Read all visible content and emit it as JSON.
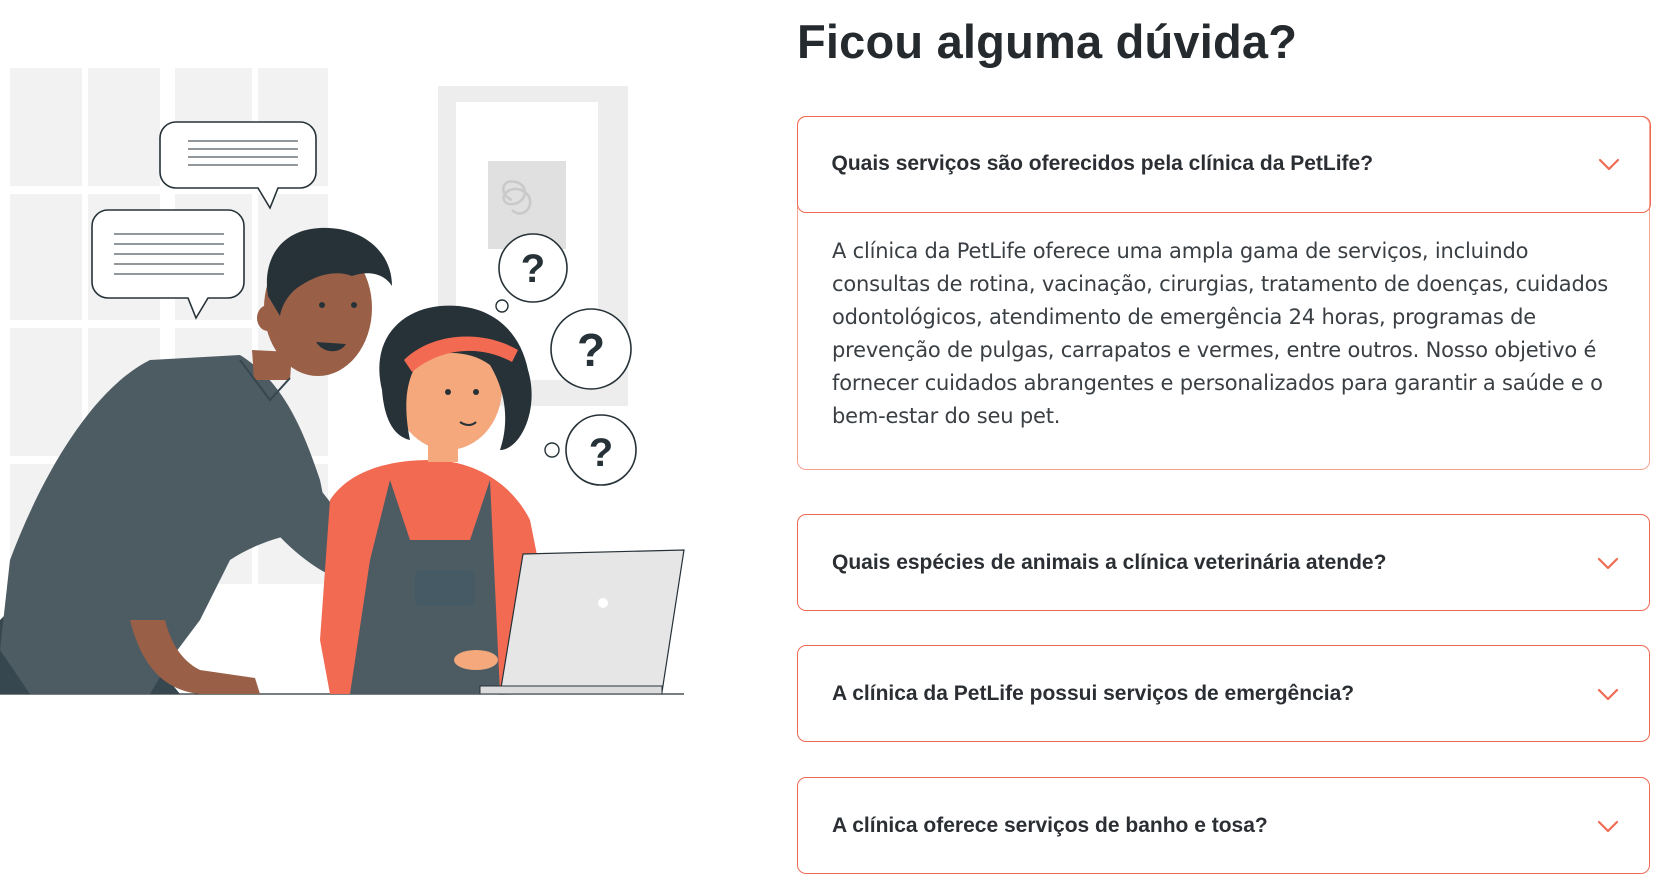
{
  "faq": {
    "title": "Ficou alguma dúvida?",
    "items": [
      {
        "question": "Quais serviços são oferecidos pela clínica da PetLife?",
        "expanded": true,
        "answer": "A clínica da PetLife oferece uma ampla gama de serviços, incluindo consultas de rotina, vacinação, cirurgias, tratamento de doenças, cuidados odontológicos, atendimento de emergência 24 horas, programas de prevenção de pulgas, carrapatos e vermes, entre outros. Nosso objetivo é fornecer cuidados abrangentes e personalizados para garantir a saúde e o bem-estar do seu pet."
      },
      {
        "question": "Quais espécies de animais a clínica veterinária atende?",
        "expanded": false
      },
      {
        "question": "A clínica da PetLife possui serviços de emergência?",
        "expanded": false
      },
      {
        "question": "A clínica oferece serviços de banho e tosa?",
        "expanded": false
      }
    ]
  },
  "illustration": {
    "speech_marks": [
      "?",
      "?",
      "?"
    ]
  },
  "colors": {
    "accent": "#f06b53",
    "title": "#252a2e",
    "text": "#3a3f44",
    "shirt_dark": "#4a5a63",
    "skin_dark": "#9a6047",
    "skin_light": "#f4a87c",
    "sweater": "#f26a52"
  },
  "icons": {
    "chevron": "chevron-down-icon"
  }
}
